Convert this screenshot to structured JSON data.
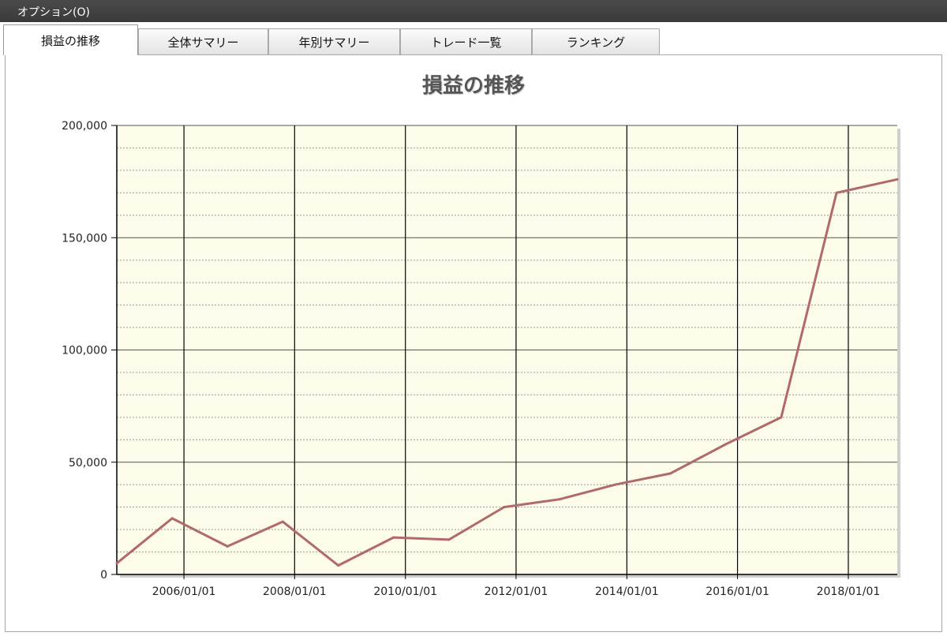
{
  "menubar": {
    "options_label": "オプション(O)"
  },
  "tabs": [
    {
      "label": "損益の推移",
      "active": true
    },
    {
      "label": "全体サマリー",
      "active": false
    },
    {
      "label": "年別サマリー",
      "active": false
    },
    {
      "label": "トレード一覧",
      "active": false
    },
    {
      "label": "ランキング",
      "active": false
    }
  ],
  "colors": {
    "plot_background": "#fdfcea",
    "line": "#b06a6a",
    "major_grid": "#000000",
    "minor_grid": "#9a9a9a"
  },
  "chart_data": {
    "type": "line",
    "title": "損益の推移",
    "xlabel": "",
    "ylabel": "",
    "x_type": "date",
    "xlim": [
      "2004-10-15",
      "2018-11-20"
    ],
    "ylim": [
      0,
      200000
    ],
    "y_ticks": [
      0,
      50000,
      100000,
      150000,
      200000
    ],
    "y_tick_labels": [
      "0",
      "50,000",
      "100,000",
      "150,000",
      "200,000"
    ],
    "x_ticks": [
      "2006-01-01",
      "2008-01-01",
      "2010-01-01",
      "2012-01-01",
      "2014-01-01",
      "2016-01-01",
      "2018-01-01"
    ],
    "x_tick_labels": [
      "2006/01/01",
      "2008/01/01",
      "2010/01/01",
      "2012/01/01",
      "2014/01/01",
      "2016/01/01",
      "2018/01/01"
    ],
    "grid": true,
    "minor_grid": true,
    "series": [
      {
        "x": [
          "2004-10-15",
          "2005-10-15",
          "2006-10-15",
          "2007-10-15",
          "2008-10-15",
          "2009-10-15",
          "2010-10-15",
          "2011-10-15",
          "2012-10-15",
          "2013-10-15",
          "2014-10-15",
          "2015-10-15",
          "2016-10-15",
          "2017-10-15",
          "2018-11-20"
        ],
        "values": [
          5000,
          25000,
          12500,
          23500,
          4000,
          16500,
          15500,
          30000,
          33500,
          40000,
          45000,
          58000,
          70000,
          170000,
          176000
        ]
      }
    ]
  }
}
